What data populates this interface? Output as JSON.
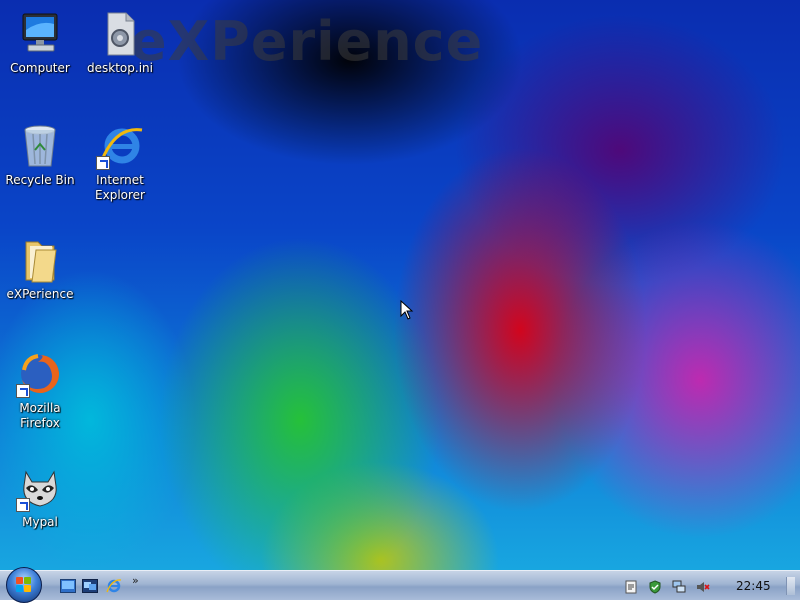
{
  "desktop": {
    "watermark": "eXPerience",
    "icons": [
      {
        "label": "Computer",
        "icon": "computer-icon"
      },
      {
        "label": "desktop.ini",
        "icon": "settings-file-icon"
      },
      {
        "label": "Recycle Bin",
        "icon": "recycle-bin-icon"
      },
      {
        "label": "Internet Explorer",
        "icon": "internet-explorer-icon",
        "shortcut": true
      },
      {
        "label": "eXPerience",
        "icon": "folder-icon"
      },
      {
        "label": "Mozilla Firefox",
        "icon": "firefox-icon",
        "shortcut": true
      },
      {
        "label": "Mypal",
        "icon": "mypal-raccoon-icon",
        "shortcut": true
      }
    ]
  },
  "taskbar": {
    "start_icon": "windows-start-orb-icon",
    "quick_launch": [
      "show-desktop-icon",
      "window-switcher-icon",
      "internet-explorer-icon"
    ],
    "overflow_label": "»",
    "tray": [
      "clipboard-icon",
      "security-shield-icon",
      "network-icon",
      "volume-muted-icon"
    ],
    "clock": "22:45"
  },
  "colors": {
    "taskbar_top": "#c6d3e6",
    "taskbar_bottom": "#8aa2c6",
    "label_text": "#ffffff"
  }
}
